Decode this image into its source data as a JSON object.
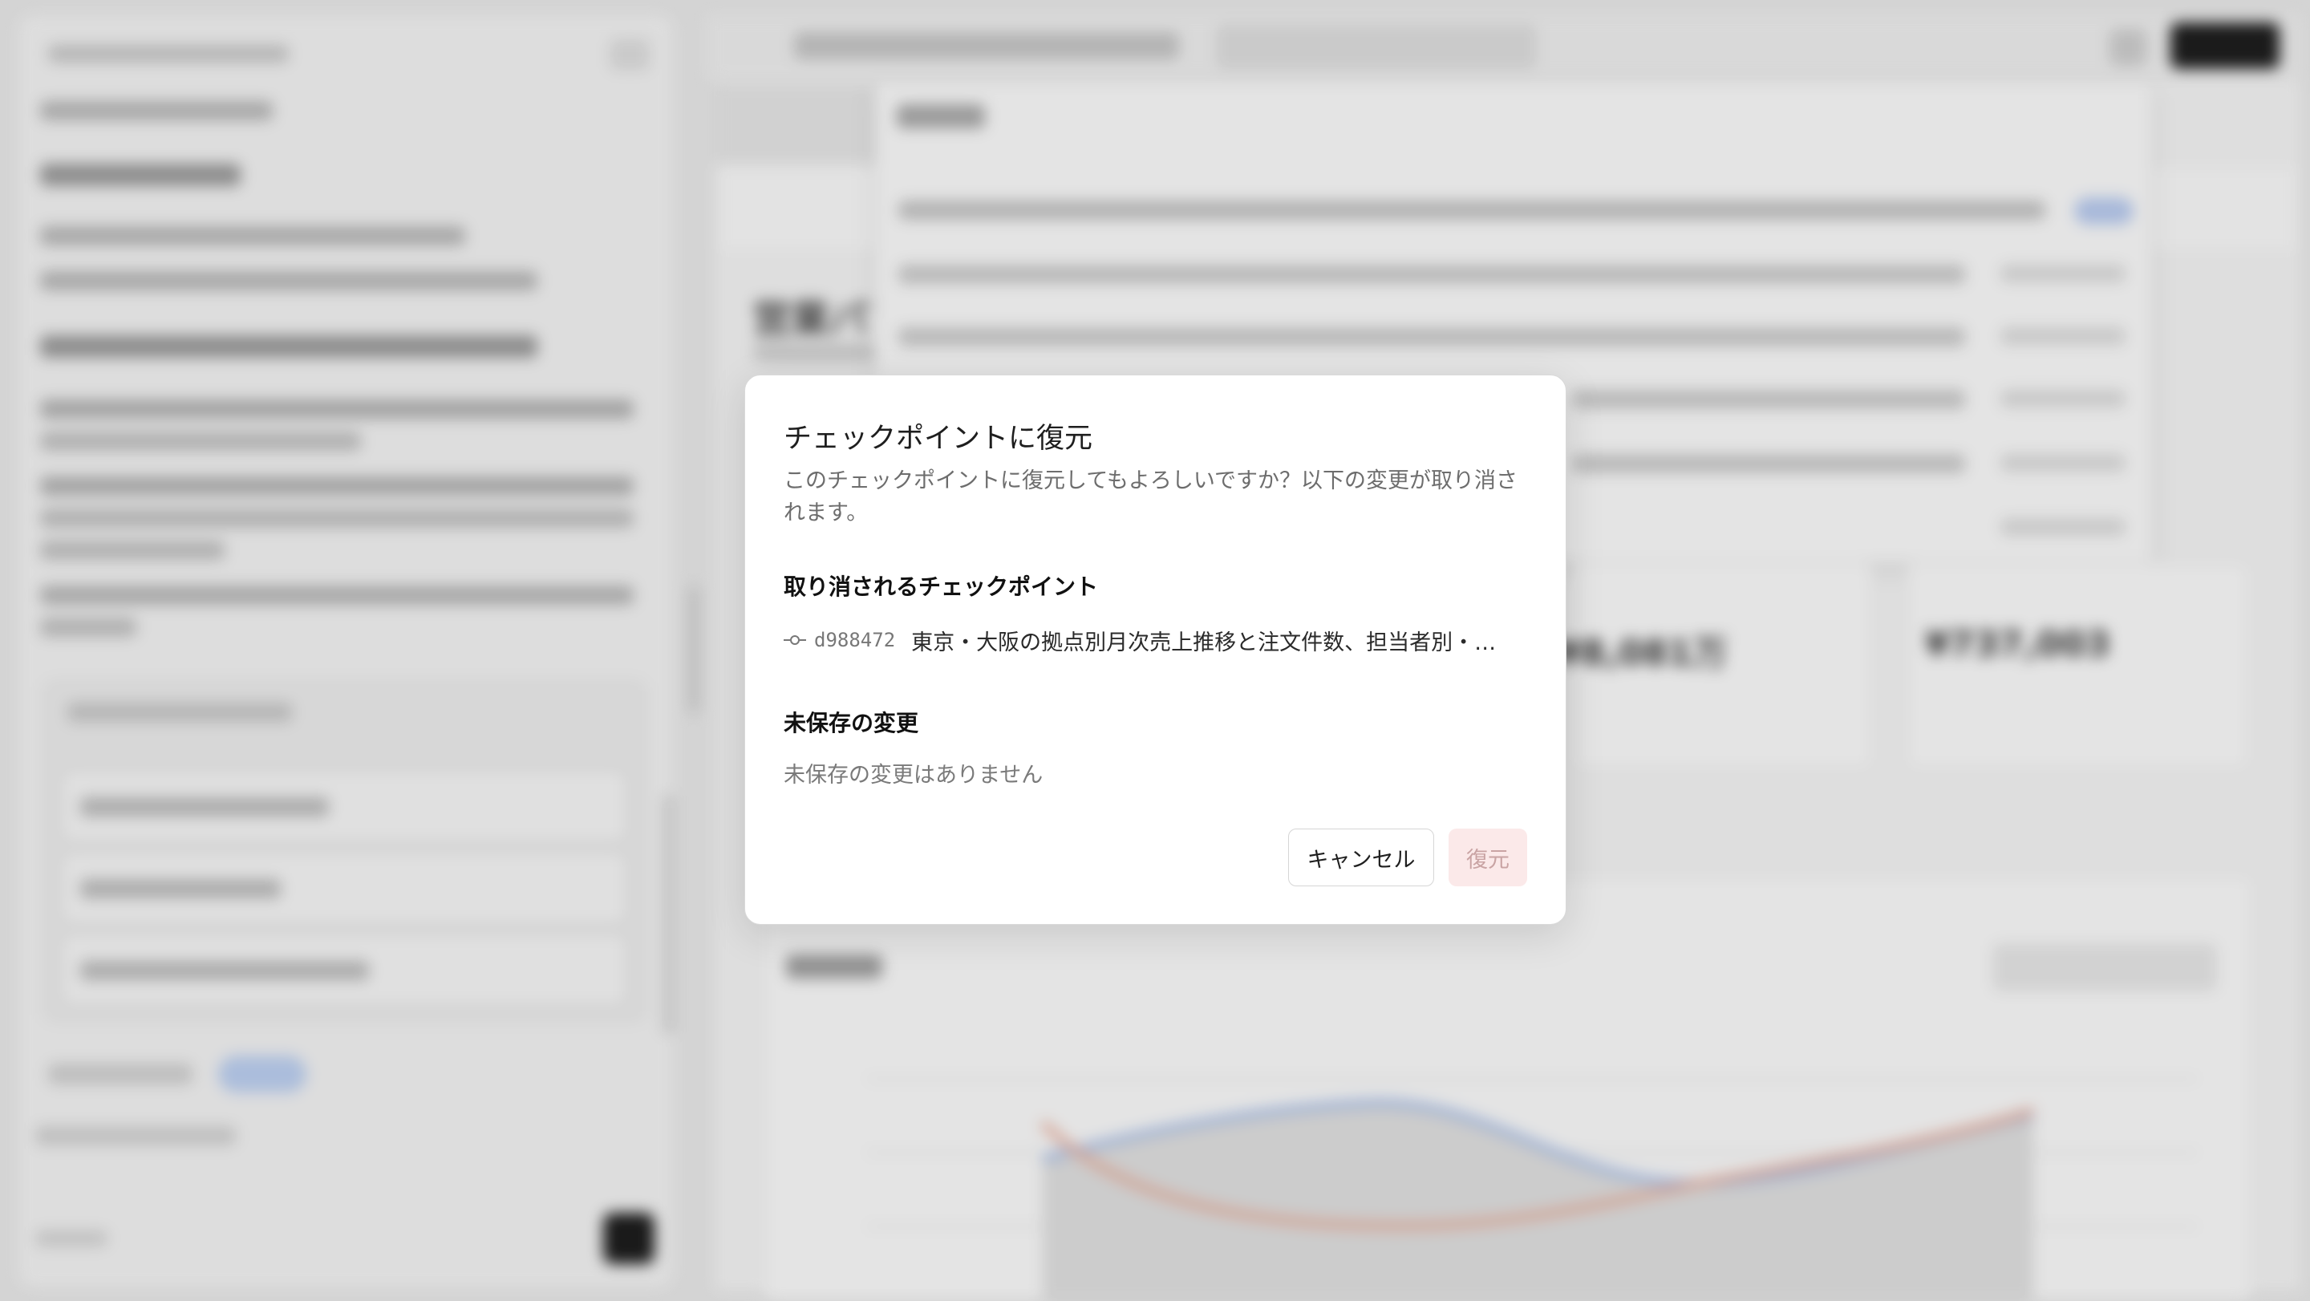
{
  "dialog": {
    "title": "チェックポイントに復元",
    "description": "このチェックポイントに復元してもよろしいですか？以下の変更が取り消されます。",
    "reverted_heading": "取り消されるチェックポイント",
    "checkpoint": {
      "hash": "d988472",
      "message": "東京・大阪の拠点別月次売上推移と注文件数、担当者別・…"
    },
    "unsaved_heading": "未保存の変更",
    "unsaved_empty": "未保存の変更はありません",
    "cancel_label": "キャンセル",
    "restore_label": "復元"
  },
  "background": {
    "kpi_values": [
      "¥8,081万",
      "¥737,003"
    ],
    "chart": {
      "series_colors": [
        "#a9bfe8",
        "#e8b1a0"
      ]
    }
  }
}
